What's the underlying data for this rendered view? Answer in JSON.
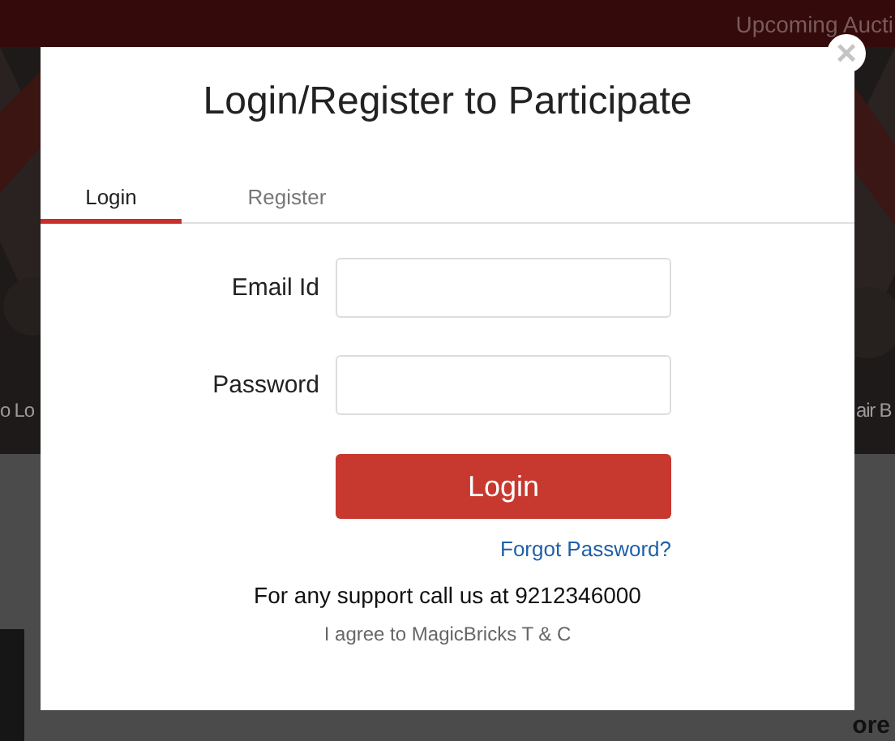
{
  "top_bar": {
    "link": "Upcoming Aucti"
  },
  "hero": {
    "kind": "picture",
    "left_text": "o Lo",
    "right_text": "air B"
  },
  "section": {
    "heading_fragment": "ore"
  },
  "dialog": {
    "close": "×",
    "title": "Login/Register to Participate",
    "tabs": [
      {
        "label": "Login",
        "selected": true
      },
      {
        "label": "Register",
        "selected": false
      }
    ],
    "fields": [
      {
        "label": "Email Id"
      },
      {
        "label": "Password"
      }
    ],
    "submit": "Login",
    "forgot": "Forgot Password?",
    "support": "For any support call us at 9212346000",
    "terms": "I agree to MagicBricks T & C"
  }
}
